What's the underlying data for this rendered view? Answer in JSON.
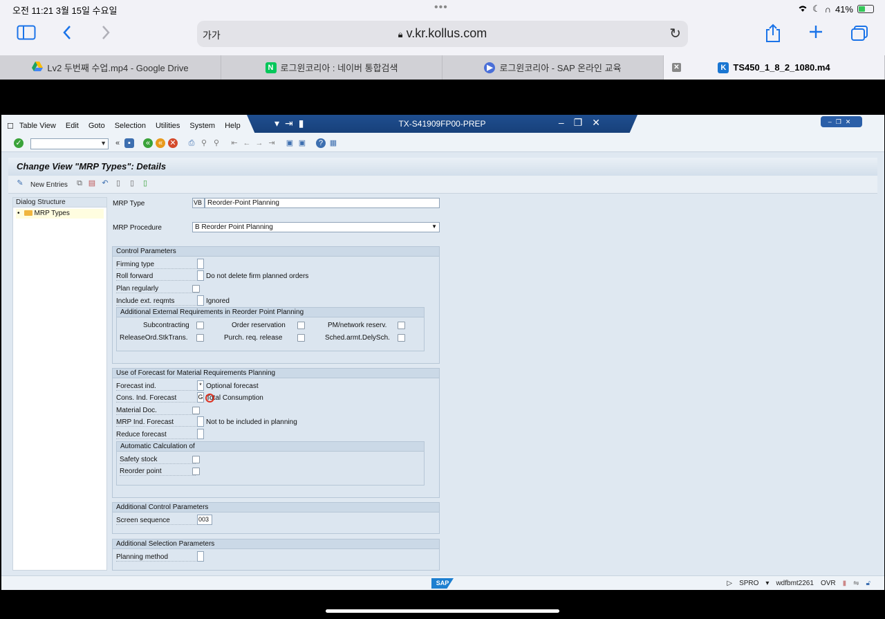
{
  "ipad": {
    "status_time": "오전 11:21   3월 15일 수요일",
    "status_dots": "•••",
    "battery": "41%",
    "battery_level": 0.41
  },
  "safari": {
    "aa": "가가",
    "url": "v.kr.kollus.com",
    "tabs": [
      {
        "label": "Lv2 두번째 수업.mp4 - Google Drive",
        "icon": "google-drive-icon"
      },
      {
        "label": "로그윈코리아 : 네이버 통합검색",
        "icon": "naver-icon"
      },
      {
        "label": "로그윈코리아 - SAP 온라인 교육",
        "icon": "play-icon"
      },
      {
        "label": "TS450_1_8_2_1080.m4",
        "icon": "kollus-icon"
      }
    ]
  },
  "sap": {
    "menu": [
      "Table View",
      "Edit",
      "Goto",
      "Selection",
      "Utilities",
      "System",
      "Help"
    ],
    "system_title": "TX-S41909FP00-PREP",
    "page_title": "Change View \"MRP Types\": Details",
    "new_entries": "New Entries",
    "dialog_structure": {
      "header": "Dialog Structure",
      "item": "MRP Types"
    },
    "mrp_type": {
      "label": "MRP Type",
      "code": "VB",
      "value": "Reorder-Point Planning"
    },
    "mrp_procedure": {
      "label": "MRP Procedure",
      "value": "B Reorder Point Planning"
    },
    "control_params": {
      "title": "Control Parameters",
      "firming_type": "Firming type",
      "roll_forward": "Roll forward",
      "roll_forward_text": "Do not delete firm planned orders",
      "plan_regularly": "Plan regularly",
      "include_ext": "Include ext. reqmts",
      "include_ext_text": "Ignored",
      "additional_ext": {
        "title": "Additional External Requirements in Reorder Point Planning",
        "subcontracting": "Subcontracting",
        "order_reservation": "Order reservation",
        "pm_network": "PM/network reserv.",
        "release_ord": "ReleaseOrd.StkTrans.",
        "purch_req": "Purch. req. release",
        "sched_armt": "Sched.armt.DelySch."
      }
    },
    "forecast": {
      "title": "Use of Forecast for Material Requirements Planning",
      "forecast_ind": "Forecast ind.",
      "forecast_ind_code": "*",
      "forecast_ind_text": "Optional forecast",
      "cons_ind": "Cons. Ind. Forecast",
      "cons_ind_code": "G",
      "cons_ind_text": "Total Consumption",
      "material_doc": "Material Doc.",
      "mrp_ind_forecast": "MRP Ind. Forecast",
      "mrp_ind_forecast_text": "Not to be included in planning",
      "reduce_forecast": "Reduce forecast",
      "auto_calc": {
        "title": "Automatic Calculation of",
        "safety_stock": "Safety stock",
        "reorder_point": "Reorder point"
      }
    },
    "additional_control": {
      "title": "Additional Control Parameters",
      "screen_sequence": "Screen sequence",
      "screen_sequence_value": "003"
    },
    "additional_selection": {
      "title": "Additional Selection Parameters",
      "planning_method": "Planning method"
    },
    "status_bar": {
      "logo": "SAP",
      "transaction": "SPRO",
      "server": "wdfbmt2261",
      "mode": "OVR"
    },
    "colors": {
      "title_bar": "#1f4e8f",
      "accent": "#1c7fd0"
    }
  }
}
